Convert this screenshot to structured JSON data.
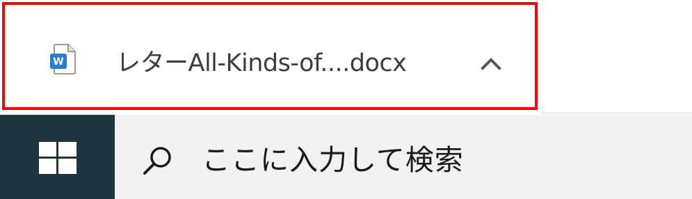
{
  "download_shelf": {
    "item": {
      "file_name": "レターAll-Kinds-of....docx",
      "file_type_icon": "word-document-icon",
      "expand_icon": "chevron-up-icon",
      "highlight_color": "#ff0000"
    }
  },
  "taskbar": {
    "start_icon": "windows-logo-icon",
    "start_background": "#1f3540",
    "search": {
      "icon": "search-icon",
      "placeholder": "ここに入力して検索"
    }
  }
}
